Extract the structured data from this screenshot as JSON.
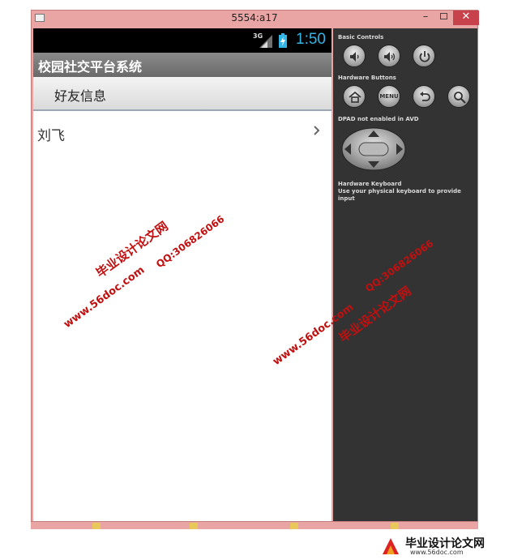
{
  "window": {
    "title": "5554:a17",
    "minimize_label": "–",
    "close_label": "✕"
  },
  "status_bar": {
    "network": "3G",
    "time": "1:50"
  },
  "app": {
    "title": "校园社交平台系统",
    "header_title": "好友信息"
  },
  "friends": [
    {
      "name": "刘飞"
    }
  ],
  "controls": {
    "basic_label": "Basic Controls",
    "hardware_label": "Hardware Buttons",
    "menu_label": "MENU",
    "dpad_label": "DPAD not enabled in AVD",
    "keyboard_label": "Hardware Keyboard",
    "keyboard_hint": "Use your physical keyboard to provide input"
  },
  "watermarks": {
    "site_cn": "毕业设计论文网",
    "qq": "QQ:306826066",
    "url": "www.56doc.com"
  },
  "logo": {
    "text": "毕业设计论文网",
    "url": "www.56doc.com"
  },
  "colors": {
    "window_frame": "#e8a5a4",
    "close_button": "#c7424b",
    "statusbar_time": "#33b5e5",
    "watermark": "#c01010"
  }
}
